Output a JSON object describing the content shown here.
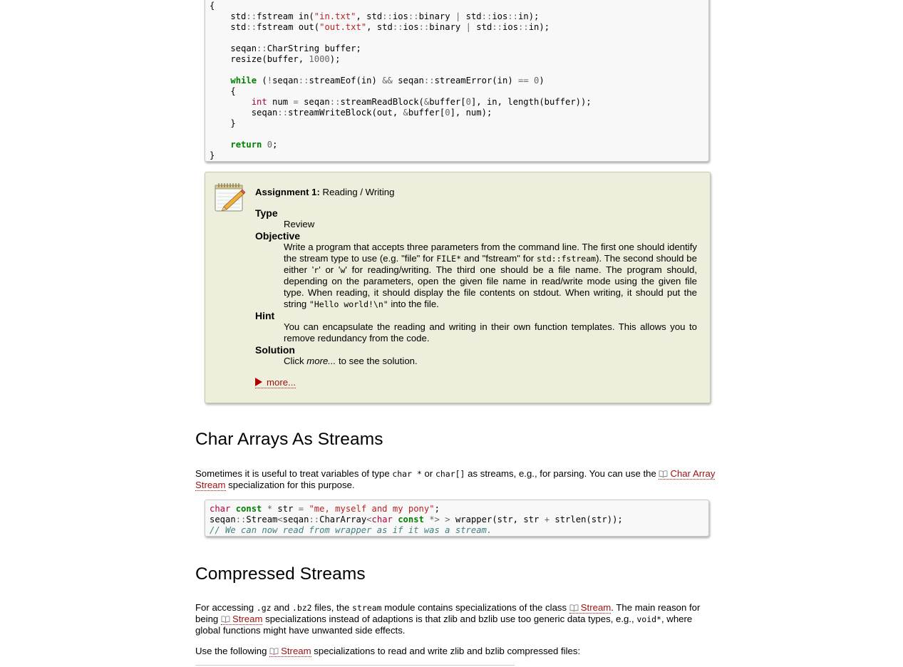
{
  "code_block_1": {
    "lines": [
      [
        {
          "t": "{",
          "c": ""
        }
      ],
      [
        {
          "t": "    std",
          "c": ""
        },
        {
          "t": "::",
          "c": "op"
        },
        {
          "t": "fstream in(",
          "c": ""
        },
        {
          "t": "\"in.txt\"",
          "c": "str"
        },
        {
          "t": ", std",
          "c": ""
        },
        {
          "t": "::",
          "c": "op"
        },
        {
          "t": "ios",
          "c": ""
        },
        {
          "t": "::",
          "c": "op"
        },
        {
          "t": "binary ",
          "c": ""
        },
        {
          "t": "|",
          "c": "op"
        },
        {
          "t": " std",
          "c": ""
        },
        {
          "t": "::",
          "c": "op"
        },
        {
          "t": "ios",
          "c": ""
        },
        {
          "t": "::",
          "c": "op"
        },
        {
          "t": "in);",
          "c": ""
        }
      ],
      [
        {
          "t": "    std",
          "c": ""
        },
        {
          "t": "::",
          "c": "op"
        },
        {
          "t": "fstream out(",
          "c": ""
        },
        {
          "t": "\"out.txt\"",
          "c": "str"
        },
        {
          "t": ", std",
          "c": ""
        },
        {
          "t": "::",
          "c": "op"
        },
        {
          "t": "ios",
          "c": ""
        },
        {
          "t": "::",
          "c": "op"
        },
        {
          "t": "binary ",
          "c": ""
        },
        {
          "t": "|",
          "c": "op"
        },
        {
          "t": " std",
          "c": ""
        },
        {
          "t": "::",
          "c": "op"
        },
        {
          "t": "ios",
          "c": ""
        },
        {
          "t": "::",
          "c": "op"
        },
        {
          "t": "in);",
          "c": ""
        }
      ],
      [
        {
          "t": "",
          "c": ""
        }
      ],
      [
        {
          "t": "    seqan",
          "c": ""
        },
        {
          "t": "::",
          "c": "op"
        },
        {
          "t": "CharString buffer;",
          "c": ""
        }
      ],
      [
        {
          "t": "    resize(buffer, ",
          "c": ""
        },
        {
          "t": "1000",
          "c": "num"
        },
        {
          "t": ");",
          "c": ""
        }
      ],
      [
        {
          "t": "",
          "c": ""
        }
      ],
      [
        {
          "t": "    ",
          "c": ""
        },
        {
          "t": "while",
          "c": "kw"
        },
        {
          "t": " (",
          "c": ""
        },
        {
          "t": "!",
          "c": "op"
        },
        {
          "t": "seqan",
          "c": ""
        },
        {
          "t": "::",
          "c": "op"
        },
        {
          "t": "streamEof(in) ",
          "c": ""
        },
        {
          "t": "&&",
          "c": "op"
        },
        {
          "t": " seqan",
          "c": ""
        },
        {
          "t": "::",
          "c": "op"
        },
        {
          "t": "streamError(in) ",
          "c": ""
        },
        {
          "t": "==",
          "c": "op"
        },
        {
          "t": " ",
          "c": ""
        },
        {
          "t": "0",
          "c": "num"
        },
        {
          "t": ")",
          "c": ""
        }
      ],
      [
        {
          "t": "    {",
          "c": ""
        }
      ],
      [
        {
          "t": "        ",
          "c": ""
        },
        {
          "t": "int",
          "c": "ty"
        },
        {
          "t": " num ",
          "c": ""
        },
        {
          "t": "=",
          "c": "op"
        },
        {
          "t": " seqan",
          "c": ""
        },
        {
          "t": "::",
          "c": "op"
        },
        {
          "t": "streamReadBlock(",
          "c": ""
        },
        {
          "t": "&",
          "c": "op"
        },
        {
          "t": "buffer[",
          "c": ""
        },
        {
          "t": "0",
          "c": "num"
        },
        {
          "t": "], in, length(buffer));",
          "c": ""
        }
      ],
      [
        {
          "t": "        seqan",
          "c": ""
        },
        {
          "t": "::",
          "c": "op"
        },
        {
          "t": "streamWriteBlock(out, ",
          "c": ""
        },
        {
          "t": "&",
          "c": "op"
        },
        {
          "t": "buffer[",
          "c": ""
        },
        {
          "t": "0",
          "c": "num"
        },
        {
          "t": "], num);",
          "c": ""
        }
      ],
      [
        {
          "t": "    }",
          "c": ""
        }
      ],
      [
        {
          "t": "",
          "c": ""
        }
      ],
      [
        {
          "t": "    ",
          "c": ""
        },
        {
          "t": "return",
          "c": "kw"
        },
        {
          "t": " ",
          "c": ""
        },
        {
          "t": "0",
          "c": "num"
        },
        {
          "t": ";",
          "c": ""
        }
      ],
      [
        {
          "t": "}",
          "c": ""
        }
      ]
    ]
  },
  "assignment": {
    "title_bold": "Assignment 1:",
    "title_rest": " Reading / Writing",
    "type_label": "Type",
    "type_value": "Review",
    "objective_label": "Objective",
    "objective_parts": [
      {
        "t": "Write a program that accepts three parameters from the command line. The first one should identify the stream type to use (e.g. \"file\" for ",
        "code": false
      },
      {
        "t": "FILE*",
        "code": true
      },
      {
        "t": " and \"fstream\" for ",
        "code": false
      },
      {
        "t": "std::fstream",
        "code": true
      },
      {
        "t": "). The second should be either '",
        "code": false
      },
      {
        "t": "r",
        "code": true
      },
      {
        "t": "' or '",
        "code": false
      },
      {
        "t": "w",
        "code": true
      },
      {
        "t": "' for reading/writing. The third one should be a file name. The program should, depending on the parameters, open the given file name in read/write mode using the given file type. When reading, it should display the file contents on stdout. When writing, it should put the string ",
        "code": false
      },
      {
        "t": "\"Hello world!\\n\"",
        "code": true
      },
      {
        "t": " into the file.",
        "code": false
      }
    ],
    "hint_label": "Hint",
    "hint_value": "You can encapsulate the reading and writing in their own function templates. This allows you to remove redundancy from the code.",
    "solution_label": "Solution",
    "solution_prefix": "Click ",
    "solution_em": "more...",
    "solution_suffix": " to see the solution.",
    "more_label": "more..."
  },
  "section_char_arrays": {
    "heading": "Char Arrays As Streams",
    "p_part1": "Sometimes it is useful to treat variables of type ",
    "code1": "char *",
    "p_part2": " or ",
    "code2": "char[]",
    "p_part3": " as streams, e.g., for parsing. You can use the ",
    "link": "Char Array Stream",
    "p_part4": " specialization for this purpose."
  },
  "code_block_2": {
    "lines": [
      [
        {
          "t": "char",
          "c": "ty"
        },
        {
          "t": " ",
          "c": ""
        },
        {
          "t": "const",
          "c": "kw"
        },
        {
          "t": " ",
          "c": ""
        },
        {
          "t": "*",
          "c": "op"
        },
        {
          "t": " str ",
          "c": ""
        },
        {
          "t": "=",
          "c": "op"
        },
        {
          "t": " ",
          "c": ""
        },
        {
          "t": "\"me, myself and my pony\"",
          "c": "str"
        },
        {
          "t": ";",
          "c": ""
        }
      ],
      [
        {
          "t": "seqan",
          "c": ""
        },
        {
          "t": "::",
          "c": "op"
        },
        {
          "t": "Stream",
          "c": ""
        },
        {
          "t": "<",
          "c": "op"
        },
        {
          "t": "seqan",
          "c": ""
        },
        {
          "t": "::",
          "c": "op"
        },
        {
          "t": "CharArray",
          "c": ""
        },
        {
          "t": "<",
          "c": "op"
        },
        {
          "t": "char",
          "c": "ty"
        },
        {
          "t": " ",
          "c": ""
        },
        {
          "t": "const",
          "c": "kw"
        },
        {
          "t": " ",
          "c": ""
        },
        {
          "t": "*>",
          "c": "op"
        },
        {
          "t": " ",
          "c": ""
        },
        {
          "t": ">",
          "c": "op"
        },
        {
          "t": " wrapper(str, str ",
          "c": ""
        },
        {
          "t": "+",
          "c": "op"
        },
        {
          "t": " strlen(str));",
          "c": ""
        }
      ],
      [
        {
          "t": "// We can now read from wrapper as if it was a stream.",
          "c": "cm"
        }
      ]
    ]
  },
  "section_compressed": {
    "heading": "Compressed Streams",
    "p1_a": "For accessing ",
    "p1_code1": ".gz",
    "p1_b": " and ",
    "p1_code2": ".bz2",
    "p1_c": " files, the ",
    "p1_code3": "stream",
    "p1_d": " module contains specializations of the class ",
    "p1_link1": "Stream",
    "p1_e": ". The main reason for being ",
    "p1_link2": "Stream",
    "p1_f": " specializations instead of adaptions is that zlib and bzlib use too generic data types, e.g., ",
    "p1_code4": "void*",
    "p1_g": ", where global functions might have unwanted side effects.",
    "p2_a": "Use the following ",
    "p2_link": "Stream",
    "p2_b": " specializations to read and write zlib and bzlib compressed files:"
  },
  "colors": {
    "link": "#9b1010",
    "assignment_bg": "#eeeedc",
    "code_bg": "#f8f8f8"
  }
}
